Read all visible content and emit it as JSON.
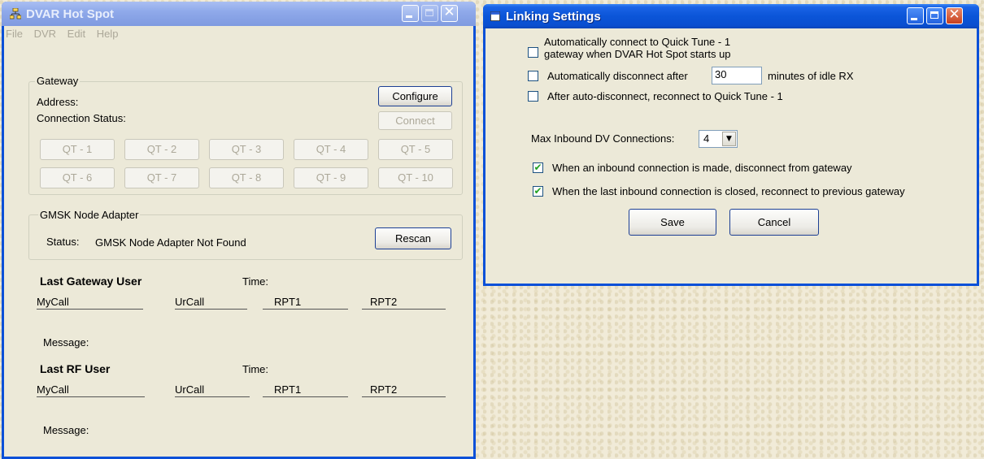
{
  "hotspot": {
    "title": "DVAR Hot Spot",
    "menu": [
      "File",
      "DVR",
      "Edit",
      "Help"
    ],
    "gateway": {
      "group_label": "Gateway",
      "address_label": "Address:",
      "status_label": "Connection Status:",
      "configure_label": "Configure",
      "connect_label": "Connect",
      "quicktunes": [
        "QT - 1",
        "QT - 2",
        "QT - 3",
        "QT - 4",
        "QT - 5",
        "QT - 6",
        "QT - 7",
        "QT - 8",
        "QT - 9",
        "QT - 10"
      ]
    },
    "gmsk": {
      "group_label": "GMSK Node Adapter",
      "status_label": "Status:",
      "status_value": "GMSK Node Adapter Not Found",
      "rescan_label": "Rescan"
    },
    "last_gateway": {
      "heading": "Last Gateway User",
      "time_label": "Time:",
      "cols": [
        "MyCall",
        "UrCall",
        "RPT1",
        "RPT2"
      ],
      "message_label": "Message:"
    },
    "last_rf": {
      "heading": "Last RF User",
      "time_label": "Time:",
      "cols": [
        "MyCall",
        "UrCall",
        "RPT1",
        "RPT2"
      ],
      "message_label": "Message:"
    }
  },
  "linking": {
    "title": "Linking Settings",
    "auto_connect_line1": "Automatically connect to Quick Tune - 1",
    "auto_connect_line2": "gateway when DVAR Hot Spot starts up",
    "auto_connect_checked": false,
    "auto_disconnect_prefix": "Automatically disconnect after",
    "idle_minutes": "30",
    "auto_disconnect_suffix": "minutes of idle RX",
    "auto_disconnect_checked": false,
    "reconnect_label": "After auto-disconnect, reconnect to Quick Tune - 1",
    "reconnect_checked": false,
    "max_inbound_label": "Max Inbound DV Connections:",
    "max_inbound_value": "4",
    "inbound_disconnect_label": "When an inbound connection is made, disconnect from gateway",
    "inbound_disconnect_checked": true,
    "inbound_reconnect_label": "When the last inbound connection is closed, reconnect to previous gateway",
    "inbound_reconnect_checked": true,
    "save_label": "Save",
    "cancel_label": "Cancel"
  },
  "colors": {
    "title_active": "#0b55d8",
    "title_inactive": "#8fa9ea",
    "window_face": "#ece9d8",
    "check_mark": "#21a121"
  }
}
